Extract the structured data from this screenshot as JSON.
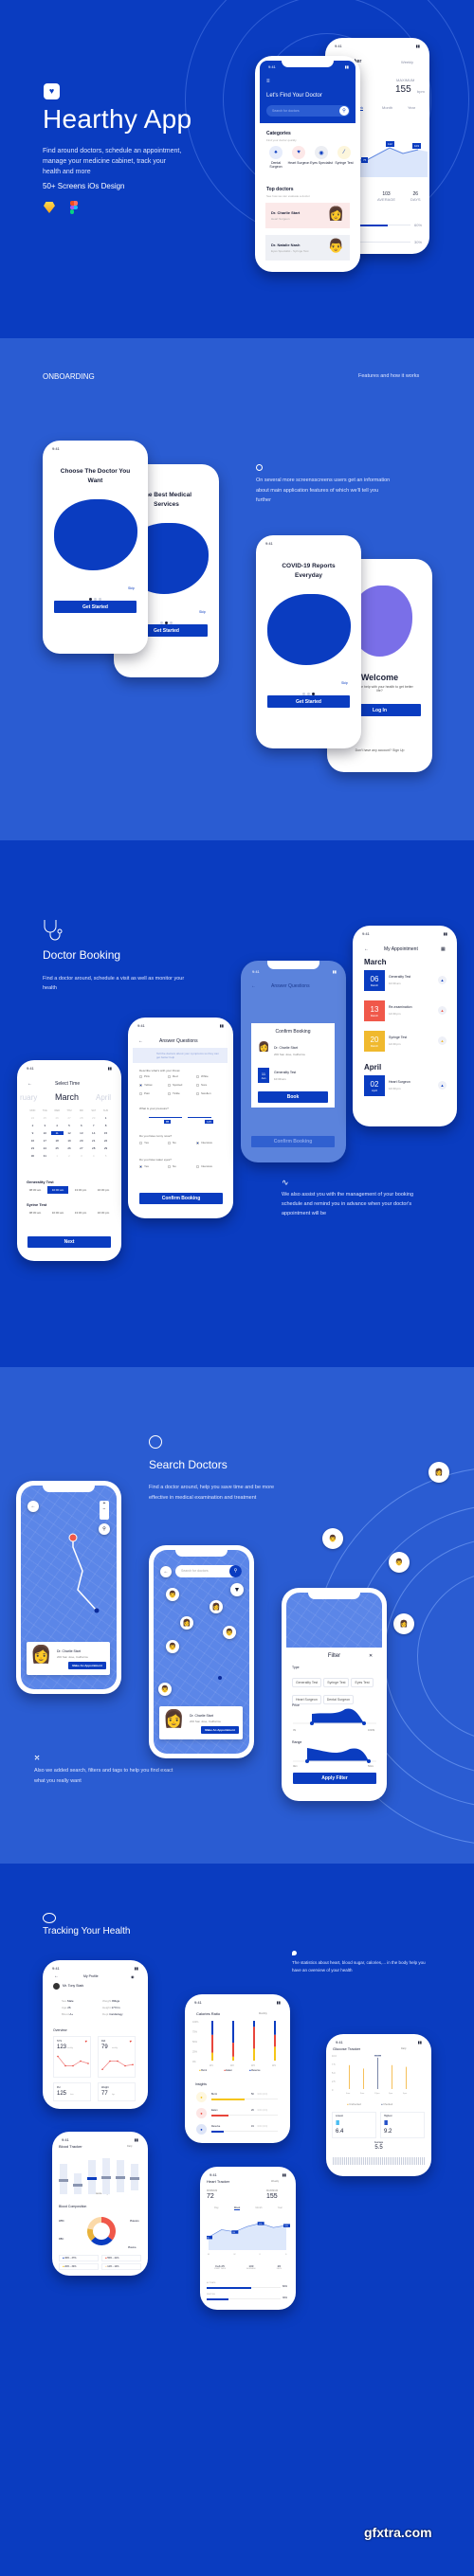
{
  "hero": {
    "logo_icon": "heart-shield-icon",
    "title": "Hearthy App",
    "description": "Find around doctors, schedule an appointment, manage your medicine cabinet, track your health and more",
    "subtitle": "50+ Screens iOs Design",
    "tools": [
      "sketch-icon",
      "figma-icon"
    ],
    "phone_front": {
      "time": "9:41",
      "heading": "Let's Find Your Doctor",
      "search_placeholder": "Search for doctors",
      "categories_title": "Categories",
      "categories_sub": "Find your doctor quickly",
      "categories": [
        {
          "label": "Dental Surgeon",
          "icon": "tooth-icon",
          "color": "#e6ecfb",
          "glyph": "♠"
        },
        {
          "label": "Heart Surgeon",
          "icon": "heart-icon",
          "color": "#fde8e8",
          "glyph": "♥"
        },
        {
          "label": "Eyes Specialist",
          "icon": "eye-icon",
          "color": "#eceef3",
          "glyph": "◉"
        },
        {
          "label": "Syringe Test",
          "icon": "syringe-icon",
          "color": "#fdf6dc",
          "glyph": "⁄"
        }
      ],
      "top_title": "Top doctors",
      "top_sub": "See how we can evaluate a doctor",
      "doctors": [
        {
          "name": "Dr. Charlie Start",
          "spec": "Heart Surgeon",
          "bg": "#fbe9e9"
        },
        {
          "name": "Dr. Natalie Nash",
          "spec": "Eyes Specialist - Syringe Test",
          "bg": "#eef0f5"
        }
      ]
    },
    "phone_back": {
      "time": "9:41",
      "title_partial": "cker",
      "period": "Weekly",
      "max_label": "MAXIMUM",
      "max_value": "155",
      "unit": "bpm",
      "tabs": [
        "Week",
        "Month",
        "Year"
      ],
      "badges": [
        "75",
        "112",
        "103"
      ],
      "stats": [
        {
          "value": "103",
          "label": "AVERAGE"
        },
        {
          "value": "26",
          "label": "DAYS"
        }
      ],
      "bars": [
        {
          "label": "60%",
          "value": 0.6
        },
        {
          "label": "30%",
          "value": 0.3
        }
      ]
    }
  },
  "onboarding": {
    "label": "ONBOARDING",
    "right_label": "Features and how it works",
    "icon": "target-icon",
    "description": "On several more screensscreens users get an information about main application features of which we'll tell you further",
    "screens": [
      {
        "title": "Choose The Doctor You Want",
        "button": "Get Started",
        "skip": "Skip",
        "active_dot": 0
      },
      {
        "title": "The Best Medical Services",
        "button": "Get Started",
        "skip": "Skip",
        "active_dot": 1
      },
      {
        "title": "COVID-19 Reports Everyday",
        "button": "Get Started",
        "skip": "Skip",
        "active_dot": 2
      },
      {
        "title": "Welcome",
        "subtitle": "Need some help with your health to get better life?",
        "button": "Log In",
        "footer": "Don't have any account? Sign Up"
      }
    ],
    "time": "9:41"
  },
  "booking": {
    "icon": "stethoscope-icon",
    "title": "Doctor Booking",
    "description": "Find a doctor around, schedule a visit as well as monitor your health",
    "note_icon": "pulse-icon",
    "note": "We also assist you with the management of your booking schedule and remind you in advance when your doctor's appointment will be",
    "select_time": {
      "title": "Select Time",
      "months": [
        "ruary",
        "March",
        "April"
      ],
      "weekdays": [
        "MON",
        "TUE",
        "WED",
        "THU",
        "FRI",
        "SAT",
        "SUN"
      ],
      "days": [
        "24",
        "25",
        "26",
        "27",
        "28",
        "29",
        "1",
        "2",
        "3",
        "4",
        "5",
        "6",
        "7",
        "8",
        "9",
        "10",
        "11",
        "12",
        "13",
        "14",
        "15",
        "16",
        "17",
        "18",
        "19",
        "20",
        "21",
        "22",
        "23",
        "24",
        "25",
        "26",
        "27",
        "28",
        "29",
        "30",
        "31",
        "1",
        "2",
        "3",
        "4",
        "5"
      ],
      "selected_day": "11",
      "section1": "Generality Test",
      "section2": "Syrine Test",
      "slots": [
        "08:30 am",
        "10:00 am",
        "13:30 pm",
        "16:30 pm"
      ],
      "selected_slot": "10:00 am",
      "button": "Next"
    },
    "questions": {
      "title": "Answer Questions",
      "hint": "Tell the doctors about your symptoms so they can get better help",
      "q1": "Describe what's with your throat",
      "q1_options": [
        "Pink",
        "Red",
        "White",
        "Yellow",
        "Spotted",
        "Sore",
        "Pain",
        "Tickle",
        "Swollen"
      ],
      "q1_checked": "Yellow",
      "q2": "What is your pressure?",
      "pressure_values": [
        "85",
        "125"
      ],
      "q3": "Do you have runny nose?",
      "q3_options": [
        "Yes",
        "No",
        "Intensive"
      ],
      "q3_checked": "Intensive",
      "q4": "Do you have water eyes?",
      "q4_options": [
        "Yes",
        "No",
        "Intensive"
      ],
      "q4_checked": "Yes",
      "button": "Confirm Booking"
    },
    "confirm": {
      "title": "Confirm Booking",
      "doctor": "Dr. Charlie Start",
      "address": "200 San Jose, California",
      "test": "Generality Test",
      "date_day": "11",
      "date_month": "Jan",
      "time": "10:30 am",
      "button": "Book"
    },
    "appointments": {
      "title": "My Appointment",
      "months": [
        {
          "name": "March",
          "items": [
            {
              "day": "06",
              "month": "March",
              "name": "Generality Test",
              "time": "10:30 am",
              "color": "#0a3cc0"
            },
            {
              "day": "13",
              "month": "March",
              "name": "Re-examination",
              "time": "14:30 pm",
              "color": "#f0584a"
            },
            {
              "day": "20",
              "month": "March",
              "name": "Syringe Test",
              "time": "14:30 pm",
              "color": "#f0b92e"
            }
          ]
        },
        {
          "name": "April",
          "items": [
            {
              "day": "02",
              "month": "April",
              "name": "Heart Surgeon",
              "time": "14:30 pm",
              "color": "#0a3cc0"
            }
          ]
        }
      ]
    }
  },
  "search": {
    "icon": "search-icon",
    "title": "Search Doctors",
    "description": "Find a doctor around, help you save time and be more effective in medical examination and treatment",
    "note_icon": "syringe-icon",
    "note": "Also we added search, filters and tags to help you find exact what you really want",
    "search_placeholder": "Search for doctors",
    "doctor_card": {
      "name": "Dr. Charlie Start",
      "address": "200 San Jose, California",
      "button": "Make An Appointment"
    },
    "filter": {
      "title": "Filter",
      "type_label": "Type",
      "types": [
        "Generality Test",
        "Syringe Test",
        "Eyes Test",
        "Heart Surgeon",
        "Dental Surgeon"
      ],
      "price_label": "Price",
      "price_min": "0$",
      "price_max": "1000$",
      "range_label": "Range",
      "range_min": "0km",
      "range_max": "50km",
      "button": "Apply Filter"
    }
  },
  "tracking": {
    "icon": "pie-chart-icon",
    "title": "Tracking Your Health",
    "note_icon": "drop-icon",
    "note": "The statistics about heart, blood sugar, calories,... in the body help you have an overview of your health",
    "profile": {
      "title": "My Profile",
      "name": "Mr. Tony Stark",
      "left": [
        [
          "Sex",
          "Male"
        ],
        [
          "Age",
          "26"
        ],
        [
          "Blood",
          "A+"
        ]
      ],
      "right": [
        [
          "Weight",
          "80kgs"
        ],
        [
          "Height",
          "177cm"
        ],
        [
          "Dept",
          "Cardiology"
        ]
      ],
      "overview": "Overview",
      "cards": [
        {
          "label": "SYS",
          "value": "123",
          "unit": "mmHg"
        },
        {
          "label": "DIA",
          "value": "79",
          "unit": "mmHg"
        },
        {
          "label": "Pul",
          "value": "125",
          "unit": "/min"
        },
        {
          "label": "Weight",
          "value": "77",
          "unit": "kgs"
        }
      ]
    },
    "calories": {
      "title": "Calories Ratio",
      "period": "Monthly",
      "insights": "Insights",
      "legend": [
        "Burnt",
        "Eaten",
        "Reserve"
      ],
      "insight_items": [
        {
          "name": "Burnt",
          "value": "50",
          "total": "/100 (kFit)",
          "pct": 0.5,
          "color": "#f5c518"
        },
        {
          "name": "Eaten",
          "value": "26",
          "total": "/100 (kFit)",
          "pct": 0.26,
          "color": "#e8463c"
        },
        {
          "name": "Reserve",
          "value": "19",
          "total": "/100 (kFit)",
          "pct": 0.19,
          "color": "#0a3cc0"
        }
      ]
    },
    "glucose": {
      "title": "Glucose Tracker",
      "period": "Daily",
      "legend": [
        "Unchecked",
        "Checked"
      ],
      "lowest_label": "Lowest",
      "lowest": "6.4",
      "highest_label": "Highest",
      "highest": "9.2",
      "unit": "mmol/L",
      "average_label": "Average",
      "average": "5.5"
    },
    "blood": {
      "title": "Blood Tracker",
      "period": "Daily",
      "reference": "Reference Range",
      "composition": "Blood Composition",
      "labels": [
        "WBC",
        "RBC",
        "Platelets",
        "Plasma"
      ],
      "legend": [
        "36% - 37%",
        "55% - 41%",
        "20% - 34%",
        "12% - 14%"
      ]
    },
    "heart": {
      "title": "Heart Tracker",
      "period": "Weekly",
      "min_label": "MINIMUM",
      "min": "72",
      "max_label": "MAXIMUM",
      "max": "155",
      "unit": "bpm",
      "tabs": [
        "Day",
        "Week",
        "Month",
        "Year"
      ],
      "active_tab": "Week",
      "stats": [
        {
          "value": "Feb 25",
          "label": "START DAYS"
        },
        {
          "value": "103",
          "label": "AVERAGE"
        },
        {
          "value": "26",
          "label": "DAYS"
        }
      ],
      "bars": [
        {
          "label": "ACTIVATE",
          "pct": "60%",
          "value": 0.6
        },
        {
          "label": "RESTING",
          "pct": "30%",
          "value": 0.3
        }
      ]
    }
  },
  "chart_data": [
    {
      "type": "bar",
      "title": "Calories Ratio",
      "categories": [
        "W1",
        "W2",
        "W3",
        "W4"
      ],
      "series": [
        {
          "name": "Burnt",
          "values": [
            20,
            10,
            30,
            35
          ]
        },
        {
          "name": "Eaten",
          "values": [
            45,
            35,
            55,
            30
          ]
        },
        {
          "name": "Reserve",
          "values": [
            35,
            55,
            15,
            35
          ]
        }
      ],
      "ylabel": "",
      "ylim": [
        0,
        100
      ],
      "yticks": [
        "0%",
        "25%",
        "50%",
        "75%",
        "100%"
      ]
    },
    {
      "type": "bar",
      "title": "Glucose Tracker",
      "categories": [
        "6am",
        "9am",
        "12pm",
        "3pm",
        "6pm"
      ],
      "values": [
        7.0,
        6.0,
        9.2,
        7.0,
        6.5
      ],
      "highlight": "12pm",
      "highlight_label": "9.2",
      "ylim": [
        0,
        10
      ],
      "yticks": [
        "0",
        "2.5",
        "5.0",
        "7.5",
        "10.0"
      ]
    },
    {
      "type": "line",
      "title": "Heart Tracker",
      "x": [
        "M",
        "T",
        "W",
        "T",
        "F",
        "S",
        "S"
      ],
      "values": [
        60,
        95,
        85,
        110,
        125,
        105,
        115
      ],
      "labels": {
        "0": "60",
        "2": "85",
        "4": "125",
        "6": "105"
      },
      "ylim": [
        0,
        150
      ]
    },
    {
      "type": "pie",
      "title": "Blood Composition",
      "categories": [
        "Platelets",
        "Plasma",
        "RBC",
        "WBC"
      ],
      "values": [
        36,
        27,
        15,
        22
      ],
      "colors": [
        "#f0584a",
        "#0a3cc0",
        "#e8b23a",
        "#fbd9a8"
      ]
    },
    {
      "type": "line",
      "title": "SYS",
      "values": [
        150,
        110,
        110,
        130,
        120
      ],
      "ylim": [
        80,
        160
      ]
    },
    {
      "type": "line",
      "title": "DIA",
      "values": [
        95,
        130,
        130,
        110,
        115
      ],
      "ylim": [
        80,
        160
      ]
    }
  ]
}
